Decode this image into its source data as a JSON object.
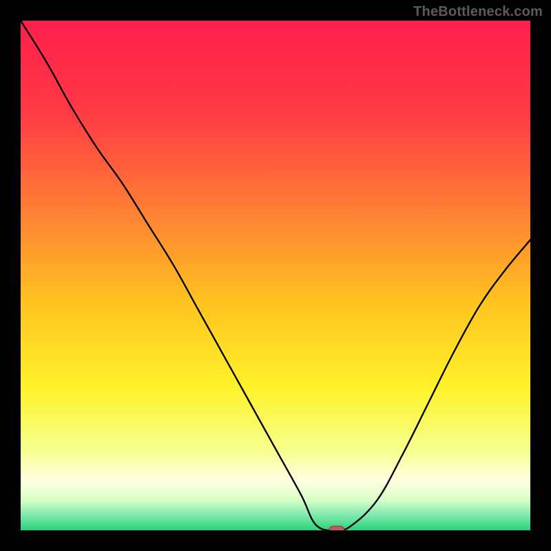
{
  "watermark": "TheBottleneck.com",
  "chart_data": {
    "type": "line",
    "title": "",
    "xlabel": "",
    "ylabel": "",
    "xlim": [
      0,
      100
    ],
    "ylim": [
      0,
      100
    ],
    "x": [
      0,
      5,
      10,
      15,
      20,
      25,
      30,
      35,
      40,
      45,
      50,
      55,
      58,
      62,
      65,
      70,
      75,
      80,
      85,
      90,
      95,
      100
    ],
    "values": [
      100,
      92,
      83,
      75,
      68,
      60,
      52,
      43,
      34,
      25,
      16,
      7,
      1,
      0,
      1,
      6,
      15,
      25,
      35,
      44,
      51,
      57
    ],
    "marker": {
      "x": 62,
      "y": 0
    },
    "gradient_stops": [
      {
        "offset": 0.0,
        "color": "#ff1f4b"
      },
      {
        "offset": 0.18,
        "color": "#ff3a44"
      },
      {
        "offset": 0.36,
        "color": "#ff7a35"
      },
      {
        "offset": 0.55,
        "color": "#ffc21f"
      },
      {
        "offset": 0.72,
        "color": "#fff22a"
      },
      {
        "offset": 0.84,
        "color": "#f6ff8a"
      },
      {
        "offset": 0.9,
        "color": "#ffffe0"
      },
      {
        "offset": 0.94,
        "color": "#d9ffc8"
      },
      {
        "offset": 0.97,
        "color": "#7fe9af"
      },
      {
        "offset": 1.0,
        "color": "#2bd27a"
      }
    ],
    "line_color": "#000000",
    "marker_fill": "#c45a5a",
    "marker_stroke": "#7a2f2f"
  }
}
